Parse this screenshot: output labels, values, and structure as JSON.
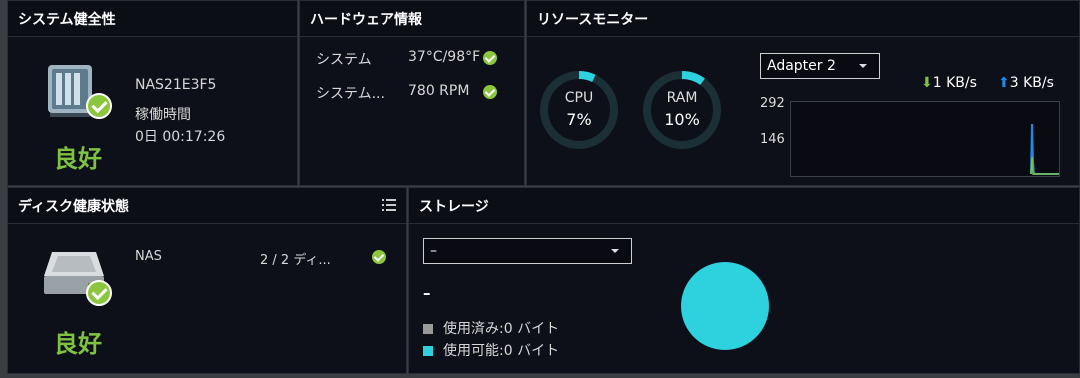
{
  "system_health": {
    "title": "システム健全性",
    "device_name": "NAS21E3F5",
    "uptime_label": "稼働時間",
    "uptime_value": "0日 00:17:26",
    "status": "良好"
  },
  "hardware_info": {
    "title": "ハードウェア情報",
    "rows": [
      {
        "label": "システム",
        "value": "37°C/98°F"
      },
      {
        "label": "システム...",
        "value": "780 RPM"
      }
    ]
  },
  "resource_monitor": {
    "title": "リソースモニター",
    "cpu": {
      "label": "CPU",
      "value": "7%",
      "percent": 7
    },
    "ram": {
      "label": "RAM",
      "value": "10%",
      "percent": 10
    },
    "adapter_selected": "Adapter 2",
    "download": "1 KB/s",
    "upload": "3 KB/s",
    "y_ticks": [
      "292",
      "146"
    ],
    "colors": {
      "download": "#7fc241",
      "upload": "#1e88e5",
      "ring": "#2ed1de",
      "ring_track": "#1b2f36"
    }
  },
  "disk_health": {
    "title": "ディスク健康状態",
    "device": "NAS",
    "disks": "2 / 2 ディ...",
    "status": "良好"
  },
  "storage": {
    "title": "ストレージ",
    "volume_selected": "–",
    "volume_name": "–",
    "used_label": "使用済み:0 バイト",
    "free_label": "使用可能:0 バイト",
    "colors": {
      "used": "#9a9a9a",
      "free": "#2ed1de"
    }
  }
}
